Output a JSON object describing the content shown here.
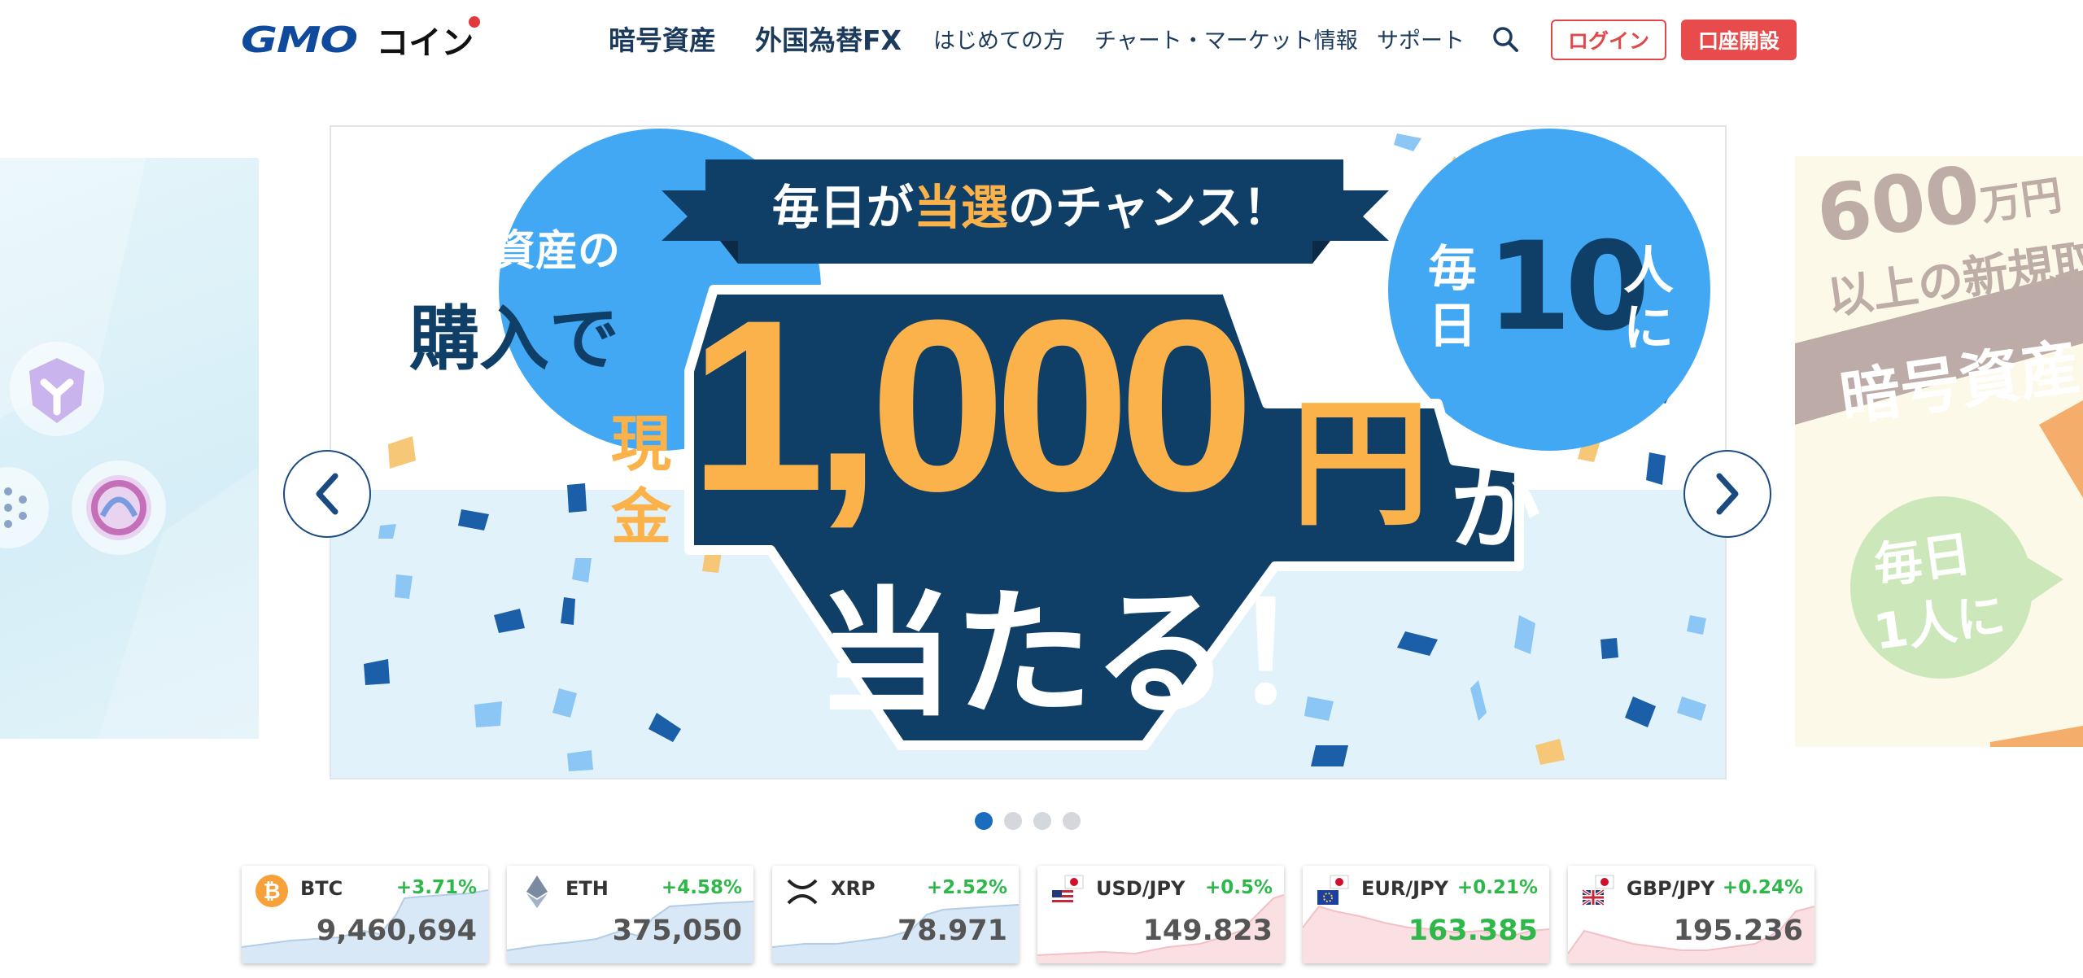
{
  "header": {
    "logo_text": "GMO",
    "logo_text_jp": "コイン",
    "nav": [
      {
        "label": "暗号資産"
      },
      {
        "label": "外国為替FX"
      },
      {
        "label": "はじめての方"
      },
      {
        "label": "チャート・マーケット情報"
      },
      {
        "label": "サポート"
      }
    ],
    "search_icon": "search-icon",
    "login_label": "ログイン",
    "open_account_label": "口座開設"
  },
  "carousel": {
    "main_banner": {
      "ribbon_text_pre": "毎日が",
      "ribbon_text_highlight": "当選",
      "ribbon_text_post": "のチャンス！",
      "left_circle_line1": "暗号資産の",
      "left_circle_line2": "購入で",
      "right_circle_every": "毎",
      "right_circle_day": "日",
      "right_circle_count": "10",
      "right_circle_person": "人",
      "right_circle_ni": "に",
      "cash_label_1": "現",
      "cash_label_2": "金",
      "amount": "1,000",
      "yen": "円",
      "ga": "が",
      "win_text": "当たる！"
    },
    "right_preview": {
      "amount": "600",
      "unit": "万円",
      "line2": "以上の新規取",
      "line3": "暗号資産",
      "circle_line1": "毎日",
      "circle_line2": "1人に"
    },
    "prev_icon": "chevron-left-icon",
    "next_icon": "chevron-right-icon",
    "page_count": 4,
    "active_page": 1
  },
  "tickers": [
    {
      "symbol": "BTC",
      "change": "+3.71%",
      "price": "9,460,694",
      "icon": "bitcoin-icon",
      "price_highlight": false,
      "chart_color": "#cfe3f5"
    },
    {
      "symbol": "ETH",
      "change": "+4.58%",
      "price": "375,050",
      "icon": "ethereum-icon",
      "price_highlight": false,
      "chart_color": "#cfe3f5"
    },
    {
      "symbol": "XRP",
      "change": "+2.52%",
      "price": "78.971",
      "icon": "xrp-icon",
      "price_highlight": false,
      "chart_color": "#cfe3f5"
    },
    {
      "symbol": "USD/JPY",
      "change": "+0.5%",
      "price": "149.823",
      "icon": "us-jp-flags-icon",
      "price_highlight": false,
      "chart_color": "#fbe0e3"
    },
    {
      "symbol": "EUR/JPY",
      "change": "+0.21%",
      "price": "163.385",
      "icon": "eu-jp-flags-icon",
      "price_highlight": true,
      "chart_color": "#fbe0e3"
    },
    {
      "symbol": "GBP/JPY",
      "change": "+0.24%",
      "price": "195.236",
      "icon": "gb-jp-flags-icon",
      "price_highlight": false,
      "chart_color": "#fbe0e3"
    }
  ],
  "colors": {
    "brand_navy": "#0f3f66",
    "accent_orange": "#fbb24a",
    "circle_blue": "#43a8f4",
    "button_red": "#e84b4b",
    "up_green": "#2fb84a"
  }
}
